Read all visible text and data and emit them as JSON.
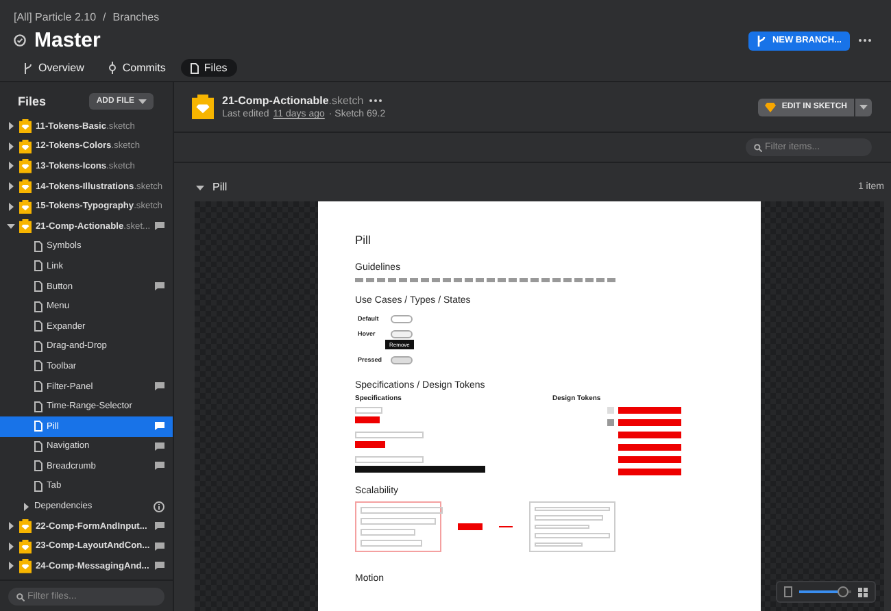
{
  "breadcrumb": {
    "project": "[All] Particle 2.10",
    "separator": "/",
    "current": "Branches"
  },
  "title": "Master",
  "new_branch_button": "NEW BRANCH...",
  "tabs": [
    {
      "label": "Overview",
      "selected": false
    },
    {
      "label": "Commits",
      "selected": false
    },
    {
      "label": "Files",
      "selected": true
    }
  ],
  "sidebar": {
    "title": "Files",
    "add_button": "ADD FILE",
    "filter_placeholder": "Filter files...",
    "items": [
      {
        "kind": "file",
        "name": "11-Tokens-Basic",
        "ext": ".sketch",
        "expanded": false,
        "comments": false,
        "selected": false
      },
      {
        "kind": "file",
        "name": "12-Tokens-Colors",
        "ext": ".sketch",
        "expanded": false,
        "comments": false,
        "selected": false
      },
      {
        "kind": "file",
        "name": "13-Tokens-Icons",
        "ext": ".sketch",
        "expanded": false,
        "comments": false,
        "selected": false
      },
      {
        "kind": "file",
        "name": "14-Tokens-Illustrations",
        "ext": ".sketch",
        "expanded": false,
        "comments": false,
        "selected": false
      },
      {
        "kind": "file",
        "name": "15-Tokens-Typography",
        "ext": ".sketch",
        "expanded": false,
        "comments": false,
        "selected": false
      },
      {
        "kind": "file",
        "name": "21-Comp-Actionable",
        "ext": ".sket...",
        "expanded": true,
        "comments": true,
        "selected": false,
        "children": [
          {
            "kind": "page",
            "name": "Symbols",
            "comments": false,
            "selected": false
          },
          {
            "kind": "page",
            "name": "Link",
            "comments": false,
            "selected": false
          },
          {
            "kind": "page",
            "name": "Button",
            "comments": true,
            "selected": false
          },
          {
            "kind": "page",
            "name": "Menu",
            "comments": false,
            "selected": false
          },
          {
            "kind": "page",
            "name": "Expander",
            "comments": false,
            "selected": false
          },
          {
            "kind": "page",
            "name": "Drag-and-Drop",
            "comments": false,
            "selected": false
          },
          {
            "kind": "page",
            "name": "Toolbar",
            "comments": false,
            "selected": false
          },
          {
            "kind": "page",
            "name": "Filter-Panel",
            "comments": true,
            "selected": false
          },
          {
            "kind": "page",
            "name": "Time-Range-Selector",
            "comments": false,
            "selected": false
          },
          {
            "kind": "page",
            "name": "Pill",
            "comments": true,
            "selected": true
          },
          {
            "kind": "page",
            "name": "Navigation",
            "comments": true,
            "selected": false
          },
          {
            "kind": "page",
            "name": "Breadcrumb",
            "comments": true,
            "selected": false
          },
          {
            "kind": "page",
            "name": "Tab",
            "comments": false,
            "selected": false
          },
          {
            "kind": "group",
            "name": "Dependencies",
            "expanded": false,
            "comments": false,
            "selected": false
          }
        ]
      },
      {
        "kind": "file",
        "name": "22-Comp-FormAndInput...",
        "expanded": false,
        "comments": true,
        "selected": false
      },
      {
        "kind": "file",
        "name": "23-Comp-LayoutAndCon...",
        "expanded": false,
        "comments": true,
        "selected": false
      },
      {
        "kind": "file",
        "name": "24-Comp-MessagingAnd...",
        "expanded": false,
        "comments": true,
        "selected": false
      }
    ]
  },
  "file_header": {
    "name": "21-Comp-Actionable",
    "ext": ".sketch",
    "meta_prefix": "Last edited",
    "meta_link": "11 days ago",
    "meta_suffix": "· Sketch 69.2",
    "edit_button": "EDIT IN SKETCH"
  },
  "filter_placeholder": "Filter items...",
  "section": {
    "title": "Pill",
    "count": "1 item",
    "expanded": true
  },
  "artboard": {
    "title": "Pill",
    "guidelines_heading": "Guidelines",
    "use_cases_heading": "Use Cases / Types / States",
    "states": [
      {
        "label": "Default",
        "kind": "default"
      },
      {
        "label": "Hover",
        "kind": "hover",
        "tooltip": "Remove"
      },
      {
        "label": "Pressed",
        "kind": "pressed"
      }
    ],
    "spec_heading": "Specifications / Design Tokens",
    "spec_label": "Specifications",
    "tokens_label": "Design Tokens",
    "scalability_heading": "Scalability",
    "motion_heading": "Motion"
  },
  "zoom": {
    "level": 0.85
  }
}
